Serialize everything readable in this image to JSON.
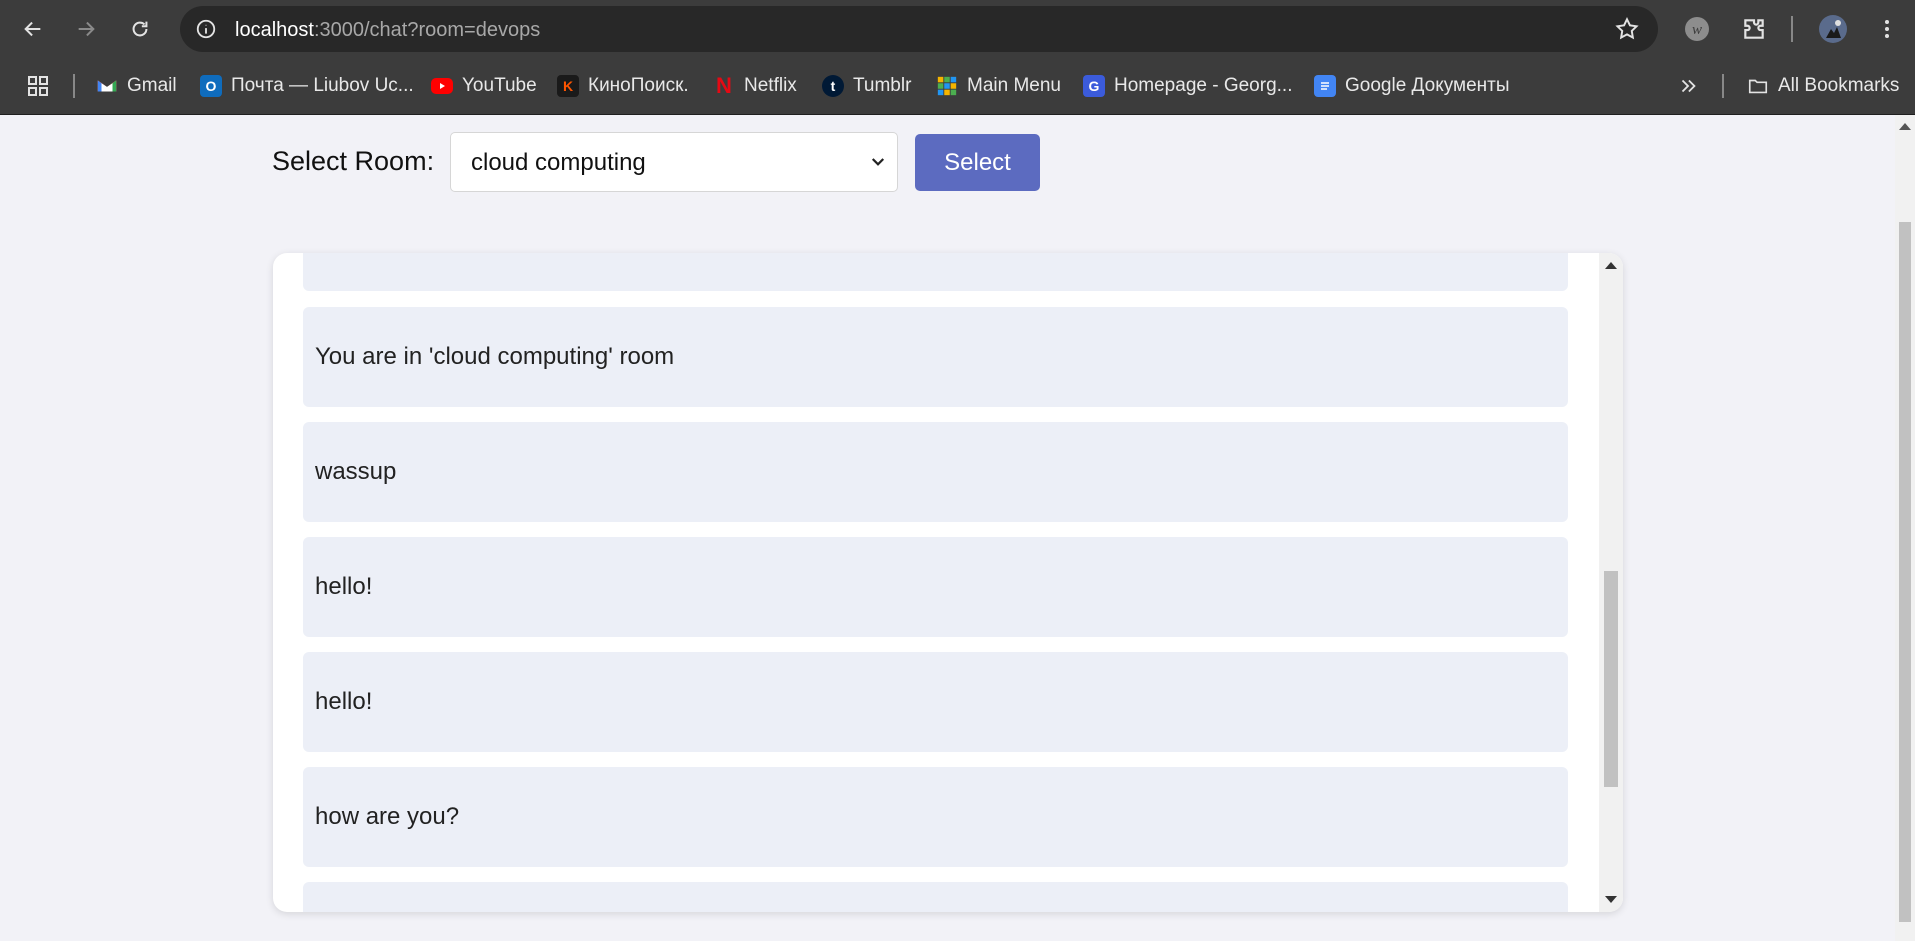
{
  "browser": {
    "url_host": "localhost",
    "url_rest": ":3000/chat?room=devops",
    "bookmarks": [
      {
        "label": "Gmail",
        "icon": "gmail-icon",
        "color": "#ea4335"
      },
      {
        "label": "Почта — Liubov Uc...",
        "icon": "outlook-icon",
        "color": "#0f6cbd"
      },
      {
        "label": "YouTube",
        "icon": "youtube-icon",
        "color": "#ff0000"
      },
      {
        "label": "КиноПоиск.",
        "icon": "kinopoisk-icon",
        "color": "#ff5500"
      },
      {
        "label": "Netflix",
        "icon": "netflix-icon",
        "color": "#e50914"
      },
      {
        "label": "Tumblr",
        "icon": "tumblr-icon",
        "color": "#001935"
      },
      {
        "label": "Main Menu",
        "icon": "grid-icon",
        "color": "#4caf50"
      },
      {
        "label": "Homepage - Georg...",
        "icon": "homepage-icon",
        "color": "#3b5bdb"
      },
      {
        "label": "Google Документы",
        "icon": "google-docs-icon",
        "color": "#4285f4"
      }
    ],
    "all_bookmarks_label": "All Bookmarks"
  },
  "room_selector": {
    "label": "Select Room:",
    "selected": "cloud computing",
    "button_label": "Select"
  },
  "messages": [
    {
      "text": ""
    },
    {
      "text": "You are in 'cloud computing' room"
    },
    {
      "text": "wassup"
    },
    {
      "text": "hello!"
    },
    {
      "text": "hello!"
    },
    {
      "text": "how are you?"
    },
    {
      "text": ""
    }
  ],
  "colors": {
    "accent": "#5c6bc0",
    "message_bg": "#eceff7",
    "page_bg": "#f2f2f7"
  }
}
